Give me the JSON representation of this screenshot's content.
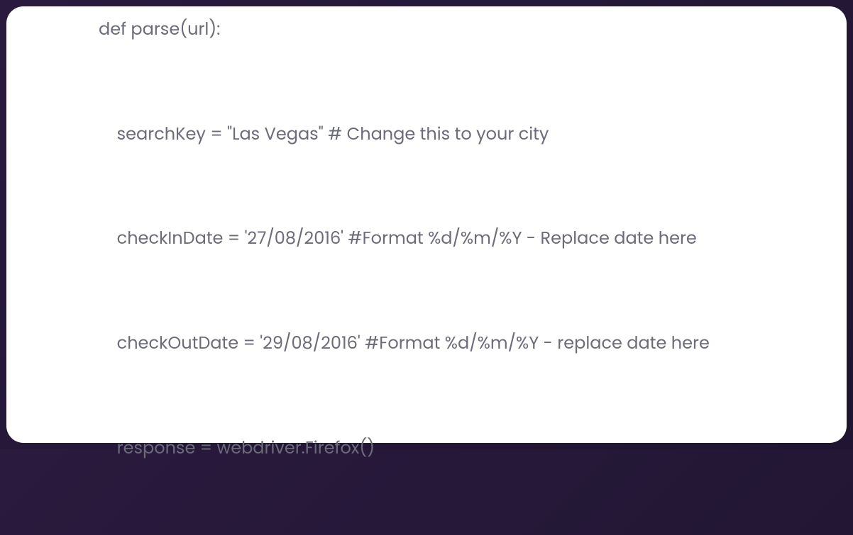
{
  "code": {
    "line1": "def parse(url):",
    "line2": "    searchKey = \"Las Vegas\" # Change this to your city",
    "line3": "    checkInDate = '27/08/2016' #Format %d/%m/%Y - Replace date here",
    "line4": "    checkOutDate = '29/08/2016' #Format %d/%m/%Y - replace date here",
    "line5": "    response = webdriver.Firefox()"
  }
}
